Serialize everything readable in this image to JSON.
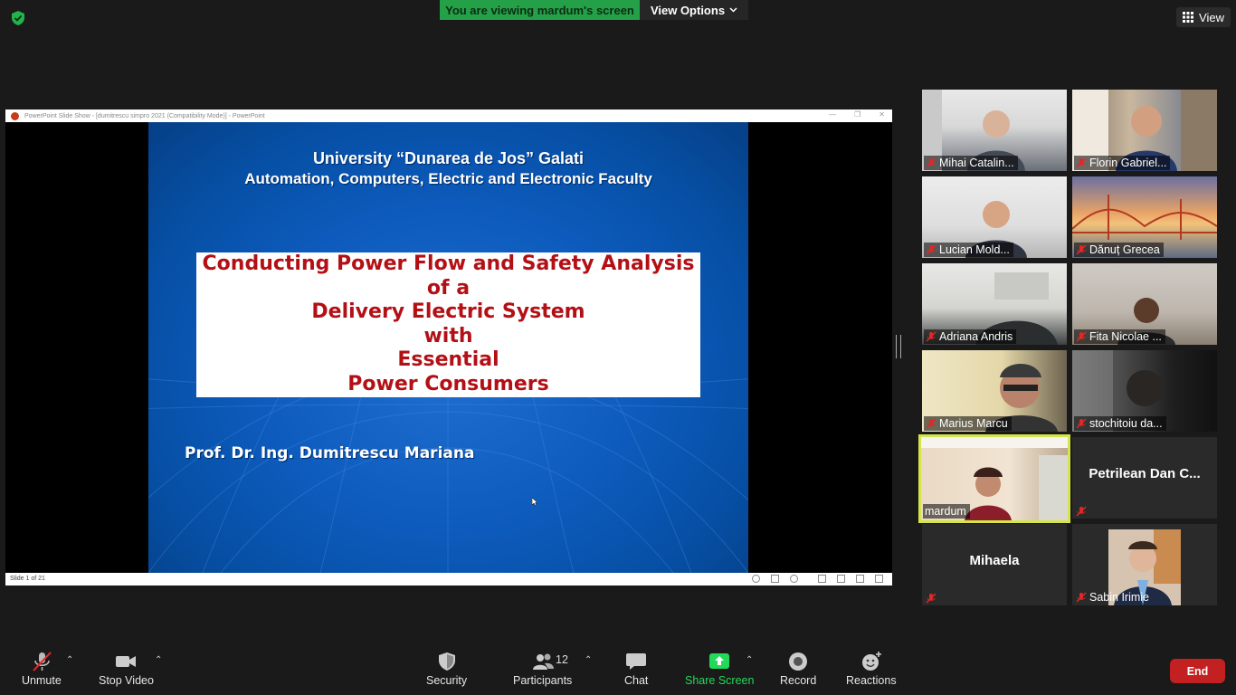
{
  "top": {
    "viewing_banner": "You are viewing mardum's screen",
    "view_options": "View Options",
    "view": "View"
  },
  "ppt": {
    "titlebar": "PowerPoint Slide Show - [dumitrescu simpro 2021 (Compatibility Mode)] - PowerPoint",
    "status": "Slide 1 of 21",
    "slide": {
      "university": "University “Dunarea de Jos” Galati",
      "faculty": "Automation, Computers, Electric and Electronic Faculty",
      "title_lines": [
        "Conducting Power Flow and Safety Analysis",
        "of a",
        "Delivery Electric System",
        "with",
        "Essential",
        "Power Consumers"
      ],
      "author": "Prof. Dr. Ing. Dumitrescu Mariana"
    }
  },
  "participants": [
    {
      "name": "Mihai Catalin..."
    },
    {
      "name": "Florin Gabriel..."
    },
    {
      "name": "Lucian Mold..."
    },
    {
      "name": "Dănuț Grecea"
    },
    {
      "name": "Adriana Andris"
    },
    {
      "name": "Fita Nicolae ..."
    },
    {
      "name": "Marius Marcu"
    },
    {
      "name": "stochitoiu da..."
    },
    {
      "name": "mardum"
    },
    {
      "name": "Petrilean Dan C..."
    },
    {
      "name": "Mihaela"
    },
    {
      "name": "Sabin Irimie"
    }
  ],
  "toolbar": {
    "unmute": "Unmute",
    "stop_video": "Stop Video",
    "security": "Security",
    "participants": "Participants",
    "participants_count": "12",
    "chat": "Chat",
    "share_screen": "Share Screen",
    "record": "Record",
    "reactions": "Reactions",
    "end": "End"
  },
  "colors": {
    "banner_green": "#24a148",
    "share_green": "#23d959",
    "end_red": "#c32121",
    "active_speaker": "#d6e54a",
    "mic_off_red": "#e02828",
    "slide_title_red": "#b31016"
  },
  "icons": [
    "shield-check-icon",
    "grid-icon",
    "microphone-off-icon",
    "camera-icon",
    "shield-icon",
    "people-icon",
    "chat-bubble-icon",
    "share-arrow-icon",
    "record-icon",
    "smiley-plus-icon",
    "chevron-down-icon",
    "chevron-up-icon"
  ]
}
